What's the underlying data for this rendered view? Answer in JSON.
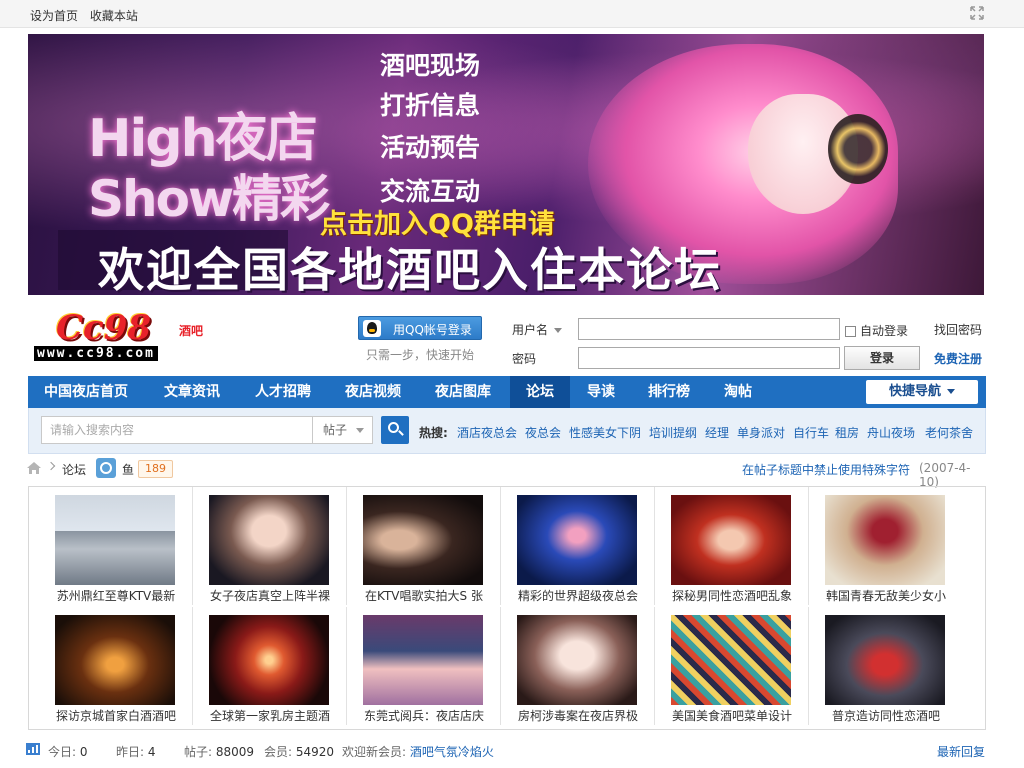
{
  "topbar": {
    "set_home": "设为首页",
    "bookmark": "收藏本站"
  },
  "banner": {
    "logo_line1": "High夜店",
    "logo_line2": "Show精彩",
    "menu": [
      "酒吧现场",
      "打折信息",
      "活动预告",
      "交流互动"
    ],
    "qq_cta": "点击加入QQ群申请",
    "welcome": "欢迎全国各地酒吧入住本论坛"
  },
  "logo": {
    "cc": "Cc98",
    "mark": "酒吧",
    "www": "www.cc98.com"
  },
  "login": {
    "qq_button": "用QQ帐号登录",
    "qq_tip": "只需一步，快速开始",
    "username_label": "用户名",
    "password_label": "密码",
    "auto_login": "自动登录",
    "login_button": "登录",
    "find_password": "找回密码",
    "register": "免费注册"
  },
  "nav": {
    "items": [
      "中国夜店首页",
      "文章资讯",
      "人才招聘",
      "夜店视频",
      "夜店图库",
      "论坛",
      "导读",
      "排行榜",
      "淘帖"
    ],
    "active": "论坛",
    "quick_nav": "快捷导航"
  },
  "search": {
    "placeholder": "请输入搜索内容",
    "type": "帖子",
    "hot_label": "热搜:",
    "hot": [
      "酒店夜总会",
      "夜总会",
      "性感美女下阴",
      "培训提纲",
      "经理",
      "单身派对",
      "自行车",
      "租房",
      "舟山夜场",
      "老何茶舍"
    ]
  },
  "breadcrumb": {
    "forum": "论坛",
    "board": "鱼",
    "count": "189",
    "notice": "在帖子标题中禁止使用特殊字符",
    "notice_date": "(2007-4-10)"
  },
  "gallery": [
    "苏州鼎红至尊KTV最新",
    "女子夜店真空上阵半裸",
    "在KTV唱歌实拍大S 张",
    "精彩的世界超级夜总会",
    "探秘男同性恋酒吧乱象",
    "韩国青春无敌美少女小",
    "探访京城首家白酒酒吧",
    "全球第一家乳房主题酒",
    "东莞式阅兵：夜店店庆",
    "房柯涉毒案在夜店界极",
    "美国美食酒吧菜单设计",
    "普京造访同性恋酒吧"
  ],
  "stats": {
    "today_label": "今日:",
    "today": "0",
    "yesterday_label": "昨日:",
    "yesterday": "4",
    "posts_label": "帖子:",
    "posts": "88009",
    "members_label": "会员:",
    "members": "54920",
    "welcome_label": "欢迎新会员:",
    "new_member": "酒吧气氛冷焰火",
    "latest": "最新回复"
  }
}
